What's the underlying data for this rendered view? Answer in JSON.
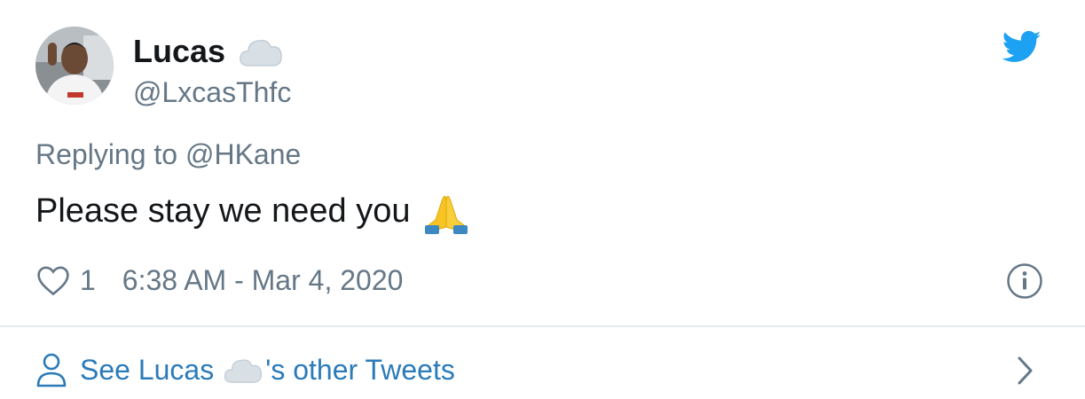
{
  "author": {
    "display_name": "Lucas",
    "handle": "@LxcasThfc"
  },
  "icons": {
    "avatar": "avatar",
    "name_emoji": "cloud-emoji",
    "logo": "twitter-bird-icon",
    "tweet_emoji": "folded-hands-emoji",
    "like": "heart-icon",
    "info": "info-icon",
    "footer_user": "user-icon",
    "footer_chevron": "chevron-right-icon"
  },
  "reply": {
    "prefix": "Replying to ",
    "mention": "@HKane"
  },
  "tweet": {
    "text": "Please stay we need you"
  },
  "meta": {
    "like_count": "1",
    "timestamp": "6:38 AM - Mar 4, 2020"
  },
  "footer": {
    "prefix": "See Lucas",
    "suffix": "'s other Tweets"
  },
  "colors": {
    "link": "#2b7bb9",
    "muted": "#657786",
    "text": "#14171a",
    "twitter_blue": "#1da1f2",
    "divider": "#e6ecf0"
  }
}
